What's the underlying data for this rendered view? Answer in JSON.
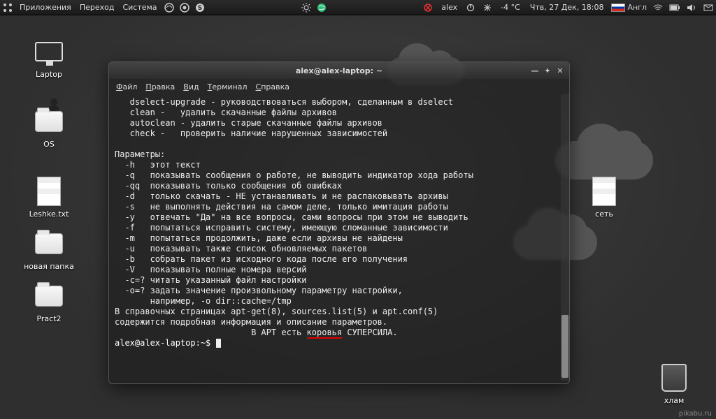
{
  "panel": {
    "menus": [
      "Приложения",
      "Переход",
      "Система"
    ],
    "apps_icon": "apps-grid-icon",
    "quick_icons": [
      "firefox-icon",
      "chrome-icon",
      "skype-icon"
    ],
    "center_icons": [
      "brightness-icon",
      "globe-icon"
    ],
    "close_icon": "close-red-icon",
    "user": "alex",
    "power_icon": "power-icon",
    "weather": "-4 °C",
    "weather_icon": "snow-icon",
    "datetime": "Чтв, 27 Дек, 18:08",
    "lang_label": "Англ",
    "tray_icons": [
      "wifi-icon",
      "battery-icon",
      "volume-icon",
      "mail-icon"
    ]
  },
  "desktop": {
    "laptop": "Laptop",
    "os": "OS",
    "leshke": "Leshke.txt",
    "newfolder": "новая папка",
    "pract2": "Pract2",
    "net_folder": "сеть",
    "trash": "хлам"
  },
  "terminal": {
    "title": "alex@alex-laptop: ~",
    "menus": {
      "file": "Файл",
      "edit": "Правка",
      "view": "Вид",
      "term": "Терминал",
      "help": "Справка"
    },
    "lines": [
      "   dselect-upgrade - руководствоваться выбором, сделанным в dselect",
      "   clean -   удалить скачанные файлы архивов",
      "   autoclean - удалить старые скачанные файлы архивов",
      "   check -   проверить наличие нарушенных зависимостей",
      "",
      "Параметры:",
      "  -h   этот текст",
      "  -q   показывать сообщения о работе, не выводить индикатор хода работы",
      "  -qq  показывать только сообщения об ошибках",
      "  -d   только скачать - НЕ устанавливать и не распаковывать архивы",
      "  -s   не выполнять действия на самом деле, только имитация работы",
      "  -y   отвечать \"Да\" на все вопросы, сами вопросы при этом не выводить",
      "  -f   попытаться исправить систему, имеющую сломанные зависимости",
      "  -m   попытаться продолжить, даже если архивы не найдены",
      "  -u   показывать также список обновляемых пакетов",
      "  -b   собрать пакет из исходного кода после его получения",
      "  -V   показывать полные номера версий",
      "  -c=? читать указанный файл настройки",
      "  -o=? задать значение произвольному параметру настройки,",
      "       например, -o dir::cache=/tmp",
      "В справочных страницах apt-get(8), sources.list(5) и apt.conf(5)",
      "содержится подробная информация и описание параметров."
    ],
    "cow_prefix": "                           В APT есть ",
    "cow_underlined": "коровья",
    "cow_suffix": " СУПЕРСИЛА.",
    "prompt": "alex@alex-laptop:~$"
  },
  "watermark": "pikabu.ru"
}
